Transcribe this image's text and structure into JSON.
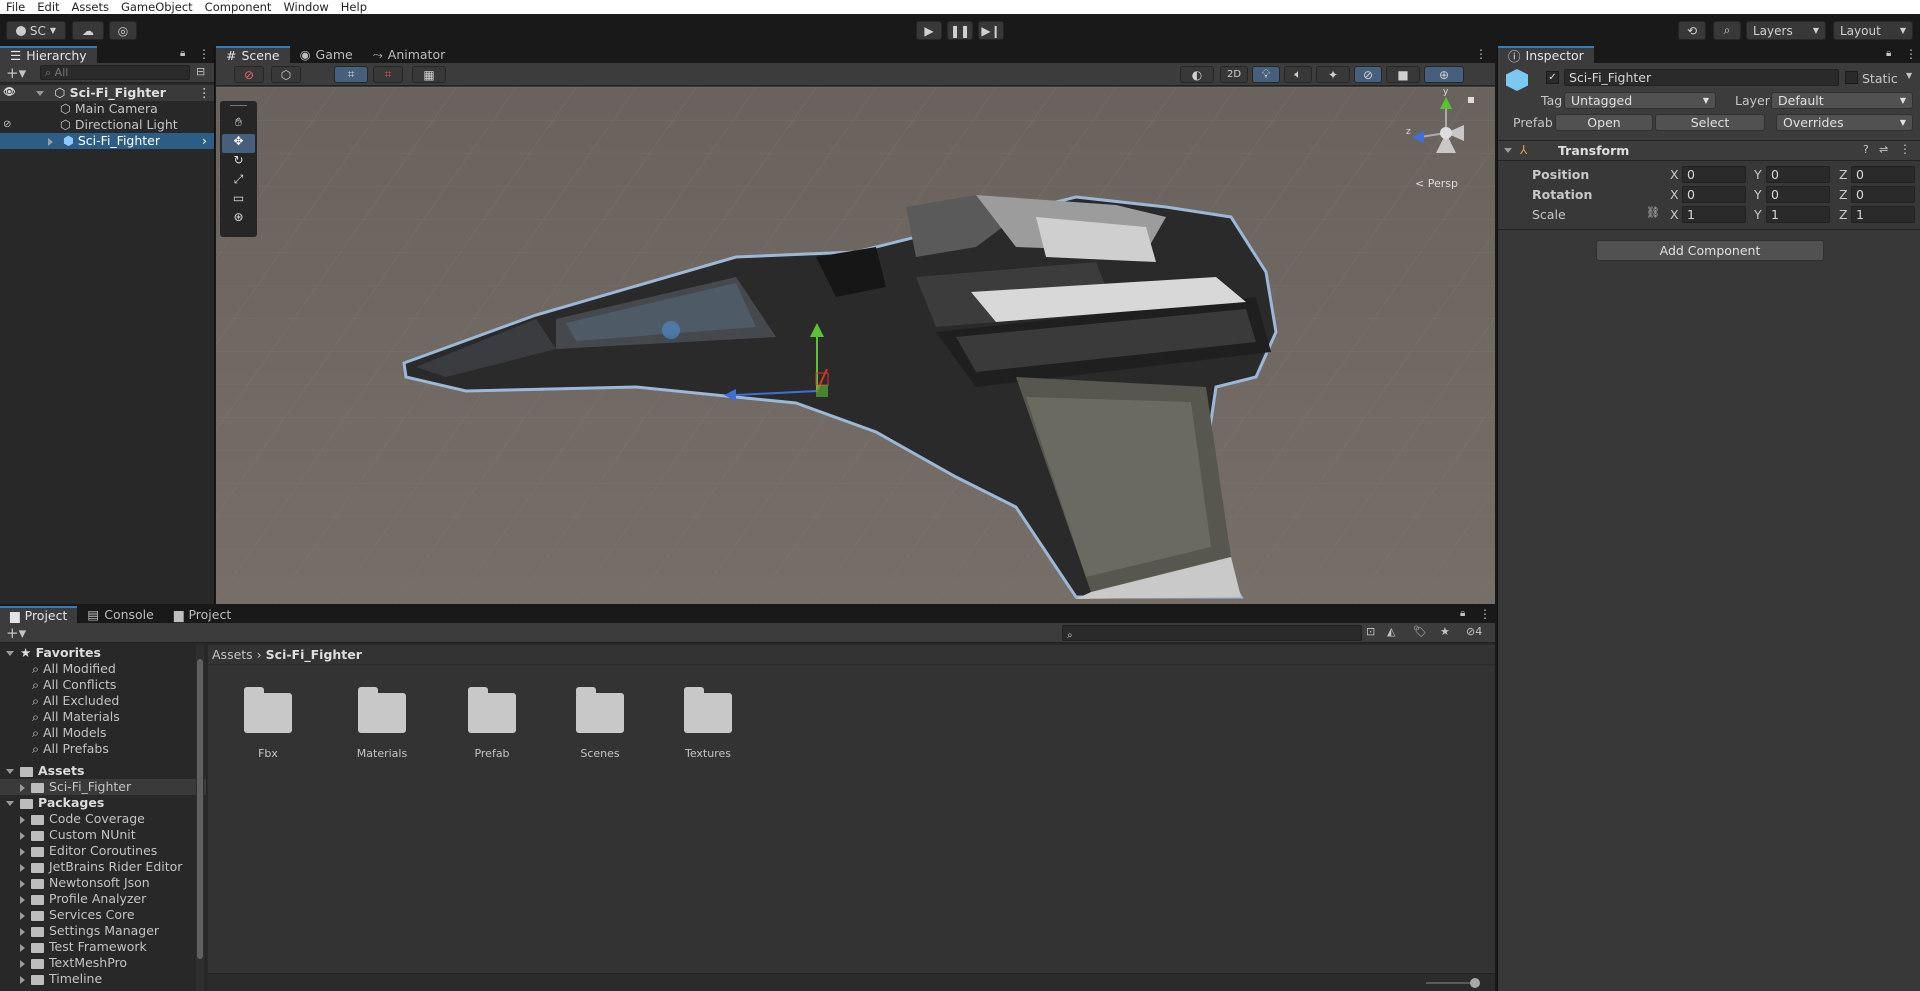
{
  "menu": [
    "File",
    "Edit",
    "Assets",
    "GameObject",
    "Component",
    "Window",
    "Help"
  ],
  "toolbar": {
    "account": "SC",
    "layers": "Layers",
    "layout": "Layout"
  },
  "hierarchy": {
    "tab": "Hierarchy",
    "search_placeholder": "All",
    "root": "Sci-Fi_Fighter",
    "items": [
      "Main Camera",
      "Directional Light",
      "Sci-Fi_Fighter"
    ]
  },
  "scene": {
    "tabs": [
      "Scene",
      "Game",
      "Animator"
    ],
    "mode_2d": "2D",
    "persp": "< Persp",
    "gizmo_axes": {
      "y": "y",
      "z": "z"
    }
  },
  "inspector": {
    "tab": "Inspector",
    "object_name": "Sci-Fi_Fighter",
    "static_label": "Static",
    "tag_label": "Tag",
    "tag_value": "Untagged",
    "layer_label": "Layer",
    "layer_value": "Default",
    "prefab_label": "Prefab",
    "open": "Open",
    "select": "Select",
    "overrides": "Overrides",
    "component": "Transform",
    "position_label": "Position",
    "rotation_label": "Rotation",
    "scale_label": "Scale",
    "position": {
      "x": "0",
      "y": "0",
      "z": "0"
    },
    "rotation": {
      "x": "0",
      "y": "0",
      "z": "0"
    },
    "scale": {
      "x": "1",
      "y": "1",
      "z": "1"
    },
    "axis": {
      "x": "X",
      "y": "Y",
      "z": "Z"
    },
    "add_component": "Add Component"
  },
  "project": {
    "tabs": [
      "Project",
      "Console",
      "Project"
    ],
    "hidden_count": "4",
    "breadcrumb": [
      "Assets",
      "Sci-Fi_Fighter"
    ],
    "favorites_label": "Favorites",
    "favorites": [
      "All Modified",
      "All Conflicts",
      "All Excluded",
      "All Materials",
      "All Models",
      "All Prefabs"
    ],
    "assets_label": "Assets",
    "assets_children": [
      "Sci-Fi_Fighter"
    ],
    "packages_label": "Packages",
    "packages": [
      "Code Coverage",
      "Custom NUnit",
      "Editor Coroutines",
      "JetBrains Rider Editor",
      "Newtonsoft Json",
      "Profile Analyzer",
      "Services Core",
      "Settings Manager",
      "Test Framework",
      "TextMeshPro",
      "Timeline"
    ],
    "folders": [
      "Fbx",
      "Materials",
      "Prefab",
      "Scenes",
      "Textures"
    ]
  },
  "colors": {
    "accent": "#3a79bb",
    "selection": "#2c5d87",
    "panel": "#383838",
    "dark": "#282828"
  }
}
